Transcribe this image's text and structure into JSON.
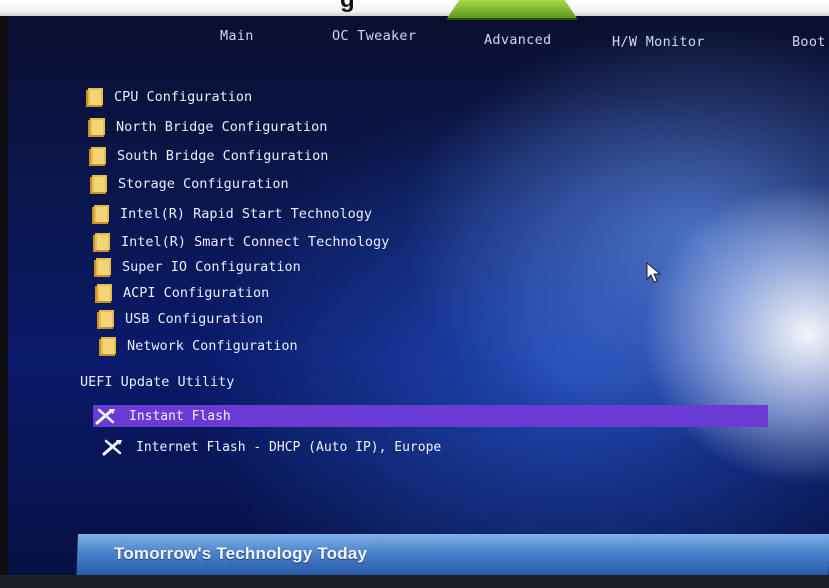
{
  "top": {
    "title_fragment": "g"
  },
  "tabs": [
    {
      "label": "Main"
    },
    {
      "label": "OC Tweaker"
    },
    {
      "label": "Advanced"
    },
    {
      "label": "H/W Monitor"
    },
    {
      "label": "Boot"
    }
  ],
  "menu": {
    "items": [
      {
        "label": "CPU Configuration"
      },
      {
        "label": "North Bridge Configuration"
      },
      {
        "label": "South Bridge Configuration"
      },
      {
        "label": "Storage Configuration"
      },
      {
        "label": "Intel(R) Rapid Start Technology"
      },
      {
        "label": "Intel(R) Smart Connect Technology"
      },
      {
        "label": "Super IO Configuration"
      },
      {
        "label": "ACPI Configuration"
      },
      {
        "label": "USB Configuration"
      },
      {
        "label": "Network Configuration"
      }
    ],
    "section_label": "UEFI Update Utility",
    "flash_items": [
      {
        "label": "Instant Flash",
        "selected": true
      },
      {
        "label": "Internet Flash - DHCP (Auto IP), Europe",
        "selected": false
      }
    ]
  },
  "footer": {
    "slogan": "Tomorrow's Technology Today"
  },
  "colors": {
    "folder": "#e0b53a",
    "selection": "#6a3ad4",
    "text": "#e8ecff",
    "footer": "#3a6fc0"
  },
  "icons": {
    "folder": "folder-icon",
    "tool": "wrench-screwdriver-icon",
    "pointer": "mouse-pointer-icon"
  }
}
